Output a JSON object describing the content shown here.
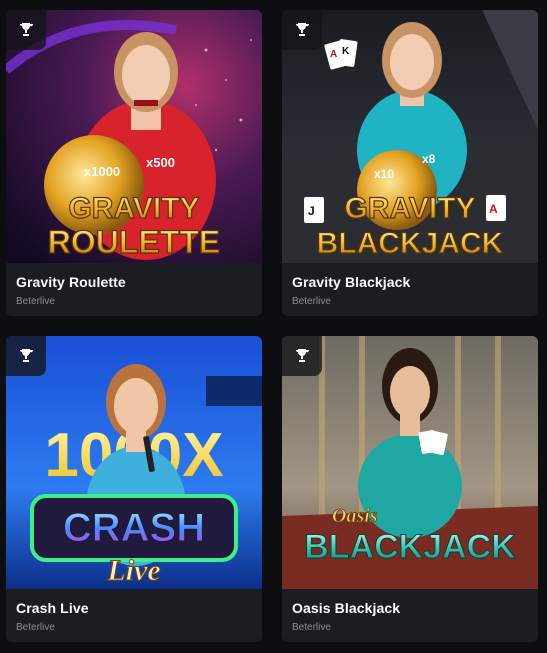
{
  "games": [
    {
      "title": "Gravity Roulette",
      "provider": "Beterlive",
      "thumb_line1": "GRAVITY",
      "thumb_line2": "ROULETTE",
      "multiplier_a": "x1000",
      "multiplier_b": "x500",
      "badge_icon": "trophy-icon"
    },
    {
      "title": "Gravity Blackjack",
      "provider": "Beterlive",
      "thumb_line1": "GRAVITY",
      "thumb_line2": "BLACKJACK",
      "multiplier_a": "x10",
      "multiplier_b": "x8",
      "badge_icon": "trophy-icon"
    },
    {
      "title": "Crash Live",
      "provider": "Beterlive",
      "thumb_line1": "CRASH",
      "thumb_line2": "Live",
      "bg_text": "1000X",
      "badge_icon": "trophy-icon"
    },
    {
      "title": "Oasis Blackjack",
      "provider": "Beterlive",
      "thumb_line1": "Oasis",
      "thumb_line2": "BLACKJACK",
      "badge_icon": "trophy-icon"
    }
  ],
  "colors": {
    "card_bg": "#1c1d23",
    "page_bg": "#0d0e12",
    "gold": "#f3b92a",
    "provider_text": "#8b8d95"
  }
}
